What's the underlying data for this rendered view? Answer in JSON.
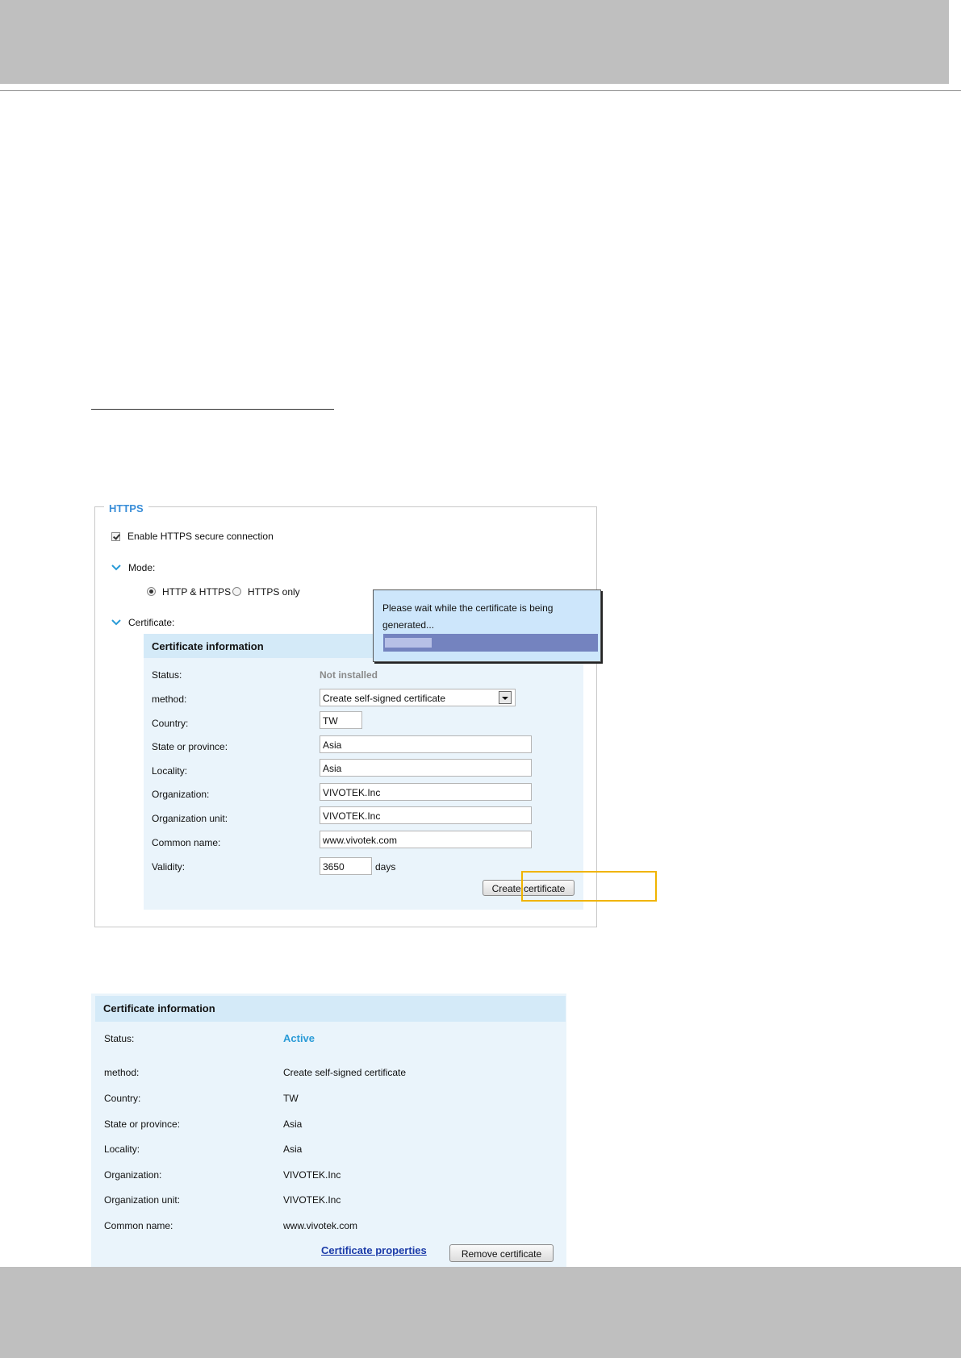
{
  "https": {
    "legend": "HTTPS",
    "enable_label": "Enable HTTPS secure connection",
    "mode_label": "Mode:",
    "mode_options": [
      "HTTP & HTTPS",
      "HTTPS only"
    ],
    "mode_selected": "HTTP & HTTPS",
    "certificate_label": "Certificate:"
  },
  "cert_form": {
    "title": "Certificate information",
    "status_label": "Status:",
    "status_value": "Not installed",
    "method_label": "method:",
    "method_value": "Create self-signed certificate",
    "country_label": "Country:",
    "country_value": "TW",
    "state_label": "State or province:",
    "state_value": "Asia",
    "locality_label": "Locality:",
    "locality_value": "Asia",
    "org_label": "Organization:",
    "org_value": "VIVOTEK.Inc",
    "org_unit_label": "Organization unit:",
    "org_unit_value": "VIVOTEK.Inc",
    "common_name_label": "Common name:",
    "common_name_value": "www.vivotek.com",
    "validity_label": "Validity:",
    "validity_value": "3650",
    "validity_unit": "days",
    "create_button": "Create certificate"
  },
  "popup": {
    "message": "Please wait while the certificate is being generated...",
    "progress": 0.22
  },
  "cert_info": {
    "title": "Certificate information",
    "status_label": "Status:",
    "status_value": "Active",
    "method_label": "method:",
    "method_value": "Create self-signed certificate",
    "country_label": "Country:",
    "country_value": "TW",
    "state_label": "State or province:",
    "state_value": "Asia",
    "locality_label": "Locality:",
    "locality_value": "Asia",
    "org_label": "Organization:",
    "org_value": "VIVOTEK.Inc",
    "org_unit_label": "Organization unit:",
    "org_unit_value": "VIVOTEK.Inc",
    "common_name_label": "Common name:",
    "common_name_value": "www.vivotek.com",
    "properties_link": "Certificate properties",
    "remove_button": "Remove certificate"
  },
  "colors": {
    "accent": "#3a8ed8",
    "status_active": "#2a9bd7",
    "panel_bg": "#eaf4fb",
    "highlight": "#f0b400"
  }
}
